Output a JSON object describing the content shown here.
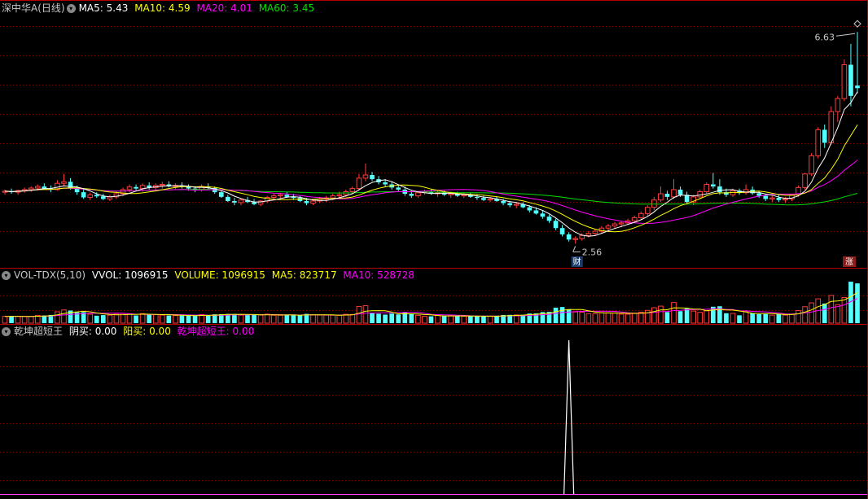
{
  "colors": {
    "up": "#ff3c3c",
    "down": "#54ffff",
    "ma5": "#ffffff",
    "ma10": "#ffff00",
    "ma20": "#ff00ff",
    "ma60": "#00e000",
    "grid": "#8b0000",
    "panel_border": "#b40000"
  },
  "price_panel": {
    "stock_name": "深中华A(日线)",
    "toggle_icon": "chevron-down-icon",
    "ma5_label": "MA5: 5.43",
    "ma10_label": "MA10: 4.59",
    "ma20_label": "MA20: 4.01",
    "ma60_label": "MA60: 3.45",
    "high_marker": "6.63",
    "low_marker": "2.56",
    "cai_badge": "财",
    "zhang_badge": "涨"
  },
  "volume_panel": {
    "title": "VOL-TDX(5,10)",
    "vvol_label": "VVOL: 1096915",
    "volume_label": "VOLUME: 1096915",
    "ma5_label": "MA5: 823717",
    "ma10_label": "MA10: 528728"
  },
  "indicator_panel": {
    "title": "乾坤超短王",
    "yinmai_label": "阴买: 0.00",
    "yangmai_label": "阳买: 0.00",
    "qiankun_label": "乾坤超短王: 0.00"
  },
  "chart_data": {
    "type": "candlestick",
    "title": "深中华A(日线)",
    "price_range": [
      2.3,
      6.9
    ],
    "high": 6.63,
    "low": 2.56,
    "candles": [
      [
        3.55,
        3.6,
        3.5,
        3.57
      ],
      [
        3.57,
        3.62,
        3.52,
        3.55
      ],
      [
        3.55,
        3.6,
        3.5,
        3.58
      ],
      [
        3.58,
        3.64,
        3.54,
        3.6
      ],
      [
        3.6,
        3.66,
        3.56,
        3.63
      ],
      [
        3.63,
        3.7,
        3.58,
        3.66
      ],
      [
        3.66,
        3.72,
        3.6,
        3.62
      ],
      [
        3.62,
        3.68,
        3.55,
        3.6
      ],
      [
        3.6,
        3.78,
        3.58,
        3.72
      ],
      [
        3.72,
        3.9,
        3.66,
        3.75
      ],
      [
        3.75,
        3.82,
        3.6,
        3.62
      ],
      [
        3.62,
        3.68,
        3.5,
        3.55
      ],
      [
        3.55,
        3.6,
        3.42,
        3.45
      ],
      [
        3.45,
        3.54,
        3.4,
        3.5
      ],
      [
        3.5,
        3.55,
        3.44,
        3.47
      ],
      [
        3.47,
        3.52,
        3.4,
        3.42
      ],
      [
        3.42,
        3.5,
        3.38,
        3.46
      ],
      [
        3.46,
        3.56,
        3.42,
        3.52
      ],
      [
        3.52,
        3.64,
        3.48,
        3.6
      ],
      [
        3.6,
        3.7,
        3.55,
        3.65
      ],
      [
        3.65,
        3.7,
        3.58,
        3.62
      ],
      [
        3.62,
        3.72,
        3.56,
        3.68
      ],
      [
        3.68,
        3.74,
        3.6,
        3.64
      ],
      [
        3.64,
        3.72,
        3.58,
        3.68
      ],
      [
        3.68,
        3.75,
        3.62,
        3.7
      ],
      [
        3.7,
        3.76,
        3.64,
        3.66
      ],
      [
        3.66,
        3.72,
        3.6,
        3.68
      ],
      [
        3.68,
        3.74,
        3.62,
        3.66
      ],
      [
        3.66,
        3.7,
        3.58,
        3.62
      ],
      [
        3.62,
        3.66,
        3.55,
        3.6
      ],
      [
        3.6,
        3.7,
        3.56,
        3.66
      ],
      [
        3.66,
        3.72,
        3.6,
        3.63
      ],
      [
        3.63,
        3.66,
        3.52,
        3.55
      ],
      [
        3.55,
        3.58,
        3.44,
        3.46
      ],
      [
        3.46,
        3.5,
        3.36,
        3.38
      ],
      [
        3.38,
        3.44,
        3.3,
        3.35
      ],
      [
        3.35,
        3.42,
        3.3,
        3.4
      ],
      [
        3.4,
        3.46,
        3.34,
        3.36
      ],
      [
        3.36,
        3.42,
        3.3,
        3.32
      ],
      [
        3.32,
        3.4,
        3.28,
        3.38
      ],
      [
        3.38,
        3.48,
        3.34,
        3.45
      ],
      [
        3.45,
        3.52,
        3.4,
        3.48
      ],
      [
        3.48,
        3.54,
        3.42,
        3.5
      ],
      [
        3.5,
        3.56,
        3.44,
        3.46
      ],
      [
        3.46,
        3.52,
        3.4,
        3.44
      ],
      [
        3.44,
        3.48,
        3.36,
        3.38
      ],
      [
        3.38,
        3.44,
        3.3,
        3.34
      ],
      [
        3.34,
        3.42,
        3.3,
        3.38
      ],
      [
        3.38,
        3.46,
        3.34,
        3.42
      ],
      [
        3.42,
        3.48,
        3.36,
        3.44
      ],
      [
        3.44,
        3.52,
        3.4,
        3.48
      ],
      [
        3.48,
        3.56,
        3.44,
        3.5
      ],
      [
        3.5,
        3.6,
        3.46,
        3.56
      ],
      [
        3.56,
        3.66,
        3.52,
        3.62
      ],
      [
        3.62,
        3.9,
        3.58,
        3.82
      ],
      [
        3.82,
        4.1,
        3.76,
        3.88
      ],
      [
        3.88,
        3.94,
        3.76,
        3.8
      ],
      [
        3.8,
        3.86,
        3.7,
        3.74
      ],
      [
        3.74,
        3.8,
        3.66,
        3.7
      ],
      [
        3.7,
        3.76,
        3.6,
        3.64
      ],
      [
        3.64,
        3.7,
        3.56,
        3.6
      ],
      [
        3.6,
        3.66,
        3.48,
        3.52
      ],
      [
        3.52,
        3.58,
        3.44,
        3.48
      ],
      [
        3.48,
        3.56,
        3.44,
        3.54
      ],
      [
        3.54,
        3.6,
        3.5,
        3.56
      ],
      [
        3.56,
        3.6,
        3.5,
        3.52
      ],
      [
        3.52,
        3.58,
        3.46,
        3.54
      ],
      [
        3.54,
        3.58,
        3.48,
        3.5
      ],
      [
        3.5,
        3.56,
        3.44,
        3.52
      ],
      [
        3.52,
        3.56,
        3.46,
        3.48
      ],
      [
        3.48,
        3.54,
        3.44,
        3.5
      ],
      [
        3.5,
        3.54,
        3.44,
        3.46
      ],
      [
        3.46,
        3.5,
        3.4,
        3.44
      ],
      [
        3.44,
        3.48,
        3.38,
        3.4
      ],
      [
        3.4,
        3.46,
        3.36,
        3.42
      ],
      [
        3.42,
        3.46,
        3.36,
        3.38
      ],
      [
        3.38,
        3.42,
        3.3,
        3.34
      ],
      [
        3.34,
        3.38,
        3.26,
        3.3
      ],
      [
        3.3,
        3.36,
        3.24,
        3.32
      ],
      [
        3.32,
        3.36,
        3.24,
        3.26
      ],
      [
        3.26,
        3.3,
        3.16,
        3.2
      ],
      [
        3.2,
        3.26,
        3.12,
        3.14
      ],
      [
        3.14,
        3.2,
        3.04,
        3.08
      ],
      [
        3.08,
        3.12,
        2.96,
        3.0
      ],
      [
        3.0,
        3.04,
        2.82,
        2.86
      ],
      [
        2.86,
        2.92,
        2.7,
        2.74
      ],
      [
        2.74,
        2.78,
        2.6,
        2.64
      ],
      [
        2.64,
        2.7,
        2.56,
        2.66
      ],
      [
        2.66,
        2.76,
        2.62,
        2.72
      ],
      [
        2.72,
        2.8,
        2.68,
        2.76
      ],
      [
        2.76,
        2.84,
        2.72,
        2.8
      ],
      [
        2.8,
        2.9,
        2.76,
        2.86
      ],
      [
        2.86,
        2.94,
        2.8,
        2.9
      ],
      [
        2.9,
        2.98,
        2.84,
        2.94
      ],
      [
        2.94,
        3.0,
        2.88,
        2.96
      ],
      [
        2.96,
        3.04,
        2.92,
        3.0
      ],
      [
        3.0,
        3.1,
        2.96,
        3.06
      ],
      [
        3.06,
        3.18,
        3.02,
        3.14
      ],
      [
        3.14,
        3.3,
        3.1,
        3.26
      ],
      [
        3.26,
        3.46,
        3.2,
        3.4
      ],
      [
        3.4,
        3.66,
        3.36,
        3.52
      ],
      [
        3.52,
        3.58,
        3.4,
        3.46
      ],
      [
        3.46,
        3.8,
        3.42,
        3.6
      ],
      [
        3.6,
        3.66,
        3.46,
        3.5
      ],
      [
        3.5,
        3.56,
        3.32,
        3.36
      ],
      [
        3.36,
        3.5,
        3.3,
        3.46
      ],
      [
        3.46,
        3.6,
        3.42,
        3.56
      ],
      [
        3.56,
        3.74,
        3.52,
        3.7
      ],
      [
        3.7,
        3.92,
        3.62,
        3.66
      ],
      [
        3.66,
        3.8,
        3.5,
        3.55
      ],
      [
        3.55,
        3.62,
        3.46,
        3.5
      ],
      [
        3.5,
        3.62,
        3.46,
        3.58
      ],
      [
        3.58,
        3.62,
        3.5,
        3.54
      ],
      [
        3.54,
        3.7,
        3.5,
        3.6
      ],
      [
        3.6,
        3.66,
        3.5,
        3.53
      ],
      [
        3.53,
        3.58,
        3.44,
        3.48
      ],
      [
        3.48,
        3.52,
        3.38,
        3.42
      ],
      [
        3.42,
        3.48,
        3.36,
        3.44
      ],
      [
        3.44,
        3.5,
        3.36,
        3.4
      ],
      [
        3.4,
        3.46,
        3.34,
        3.42
      ],
      [
        3.42,
        3.52,
        3.38,
        3.5
      ],
      [
        3.5,
        3.68,
        3.46,
        3.64
      ],
      [
        3.64,
        3.92,
        3.6,
        3.9
      ],
      [
        3.9,
        4.3,
        3.86,
        4.25
      ],
      [
        4.25,
        4.8,
        4.2,
        4.75
      ],
      [
        4.75,
        4.85,
        4.4,
        4.5
      ],
      [
        4.5,
        5.2,
        4.46,
        5.1
      ],
      [
        5.1,
        5.4,
        4.9,
        5.35
      ],
      [
        5.35,
        6.1,
        5.3,
        6.0
      ],
      [
        6.0,
        6.4,
        5.2,
        5.4
      ],
      [
        5.6,
        6.63,
        5.45,
        5.55
      ]
    ],
    "volume": {
      "title": "VOL-TDX(5,10)",
      "vvol": 1096915,
      "ma5": 823717,
      "ma10": 528728
    },
    "indicator": {
      "title": "乾坤超短王",
      "yinmai": 0.0,
      "yangmai": 0.0,
      "value": 0.0
    }
  }
}
